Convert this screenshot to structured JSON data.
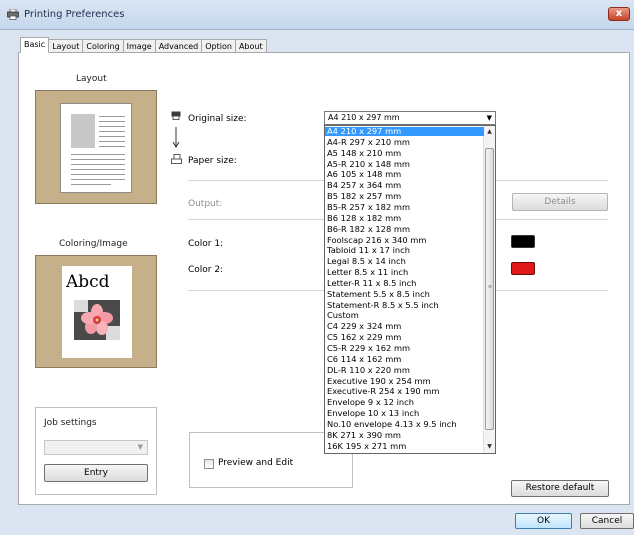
{
  "window": {
    "title": "Printing Preferences",
    "close_glyph": "x"
  },
  "tabs": [
    "Basic",
    "Layout",
    "Coloring",
    "Image",
    "Advanced",
    "Option",
    "About"
  ],
  "active_tab": "Basic",
  "sections": {
    "layout": "Layout",
    "coloring_image": "Coloring/Image",
    "job_settings": "Job settings"
  },
  "preview": {
    "sample_text": "Abcd"
  },
  "fields": {
    "original_size_label": "Original size:",
    "paper_size_label": "Paper size:",
    "output_label": "Output:",
    "color1_label": "Color 1:",
    "color2_label": "Color 2:",
    "original_size_value": "A4 210 x 297 mm"
  },
  "colors": {
    "color1": "#000000",
    "color2": "#e01818",
    "selection": "#3399ff"
  },
  "dropdown_options": [
    "A4 210 x 297 mm",
    "A4-R 297 x 210 mm",
    "A5 148 x 210 mm",
    "A5-R 210 x 148 mm",
    "A6 105 x 148 mm",
    "B4 257 x 364 mm",
    "B5 182 x 257 mm",
    "B5-R 257 x 182 mm",
    "B6 128 x 182 mm",
    "B6-R 182 x 128 mm",
    "Foolscap 216 x 340 mm",
    "Tabloid 11 x 17 inch",
    "Legal  8.5 x 14 inch",
    "Letter 8.5 x 11 inch",
    "Letter-R 11 x 8.5 inch",
    "Statement 5.5 x 8.5 inch",
    "Statement-R 8.5 x 5.5 inch",
    "Custom",
    "C4 229 x 324 mm",
    "C5 162 x 229 mm",
    "C5-R 229 x 162 mm",
    "C6 114 x 162 mm",
    "DL-R 110 x 220 mm",
    "Executive 190 x 254 mm",
    "Executive-R 254 x 190 mm",
    "Envelope 9 x 12 inch",
    "Envelope 10 x 13 inch",
    "No.10 envelope 4.13 x 9.5 inch",
    "8K 271 x 390 mm",
    "16K 195 x 271 mm"
  ],
  "selected_option_index": 0,
  "buttons": {
    "details": "Details",
    "entry": "Entry",
    "restore_default": "Restore default",
    "ok": "OK",
    "cancel": "Cancel"
  },
  "preview_and_edit": "Preview and Edit"
}
